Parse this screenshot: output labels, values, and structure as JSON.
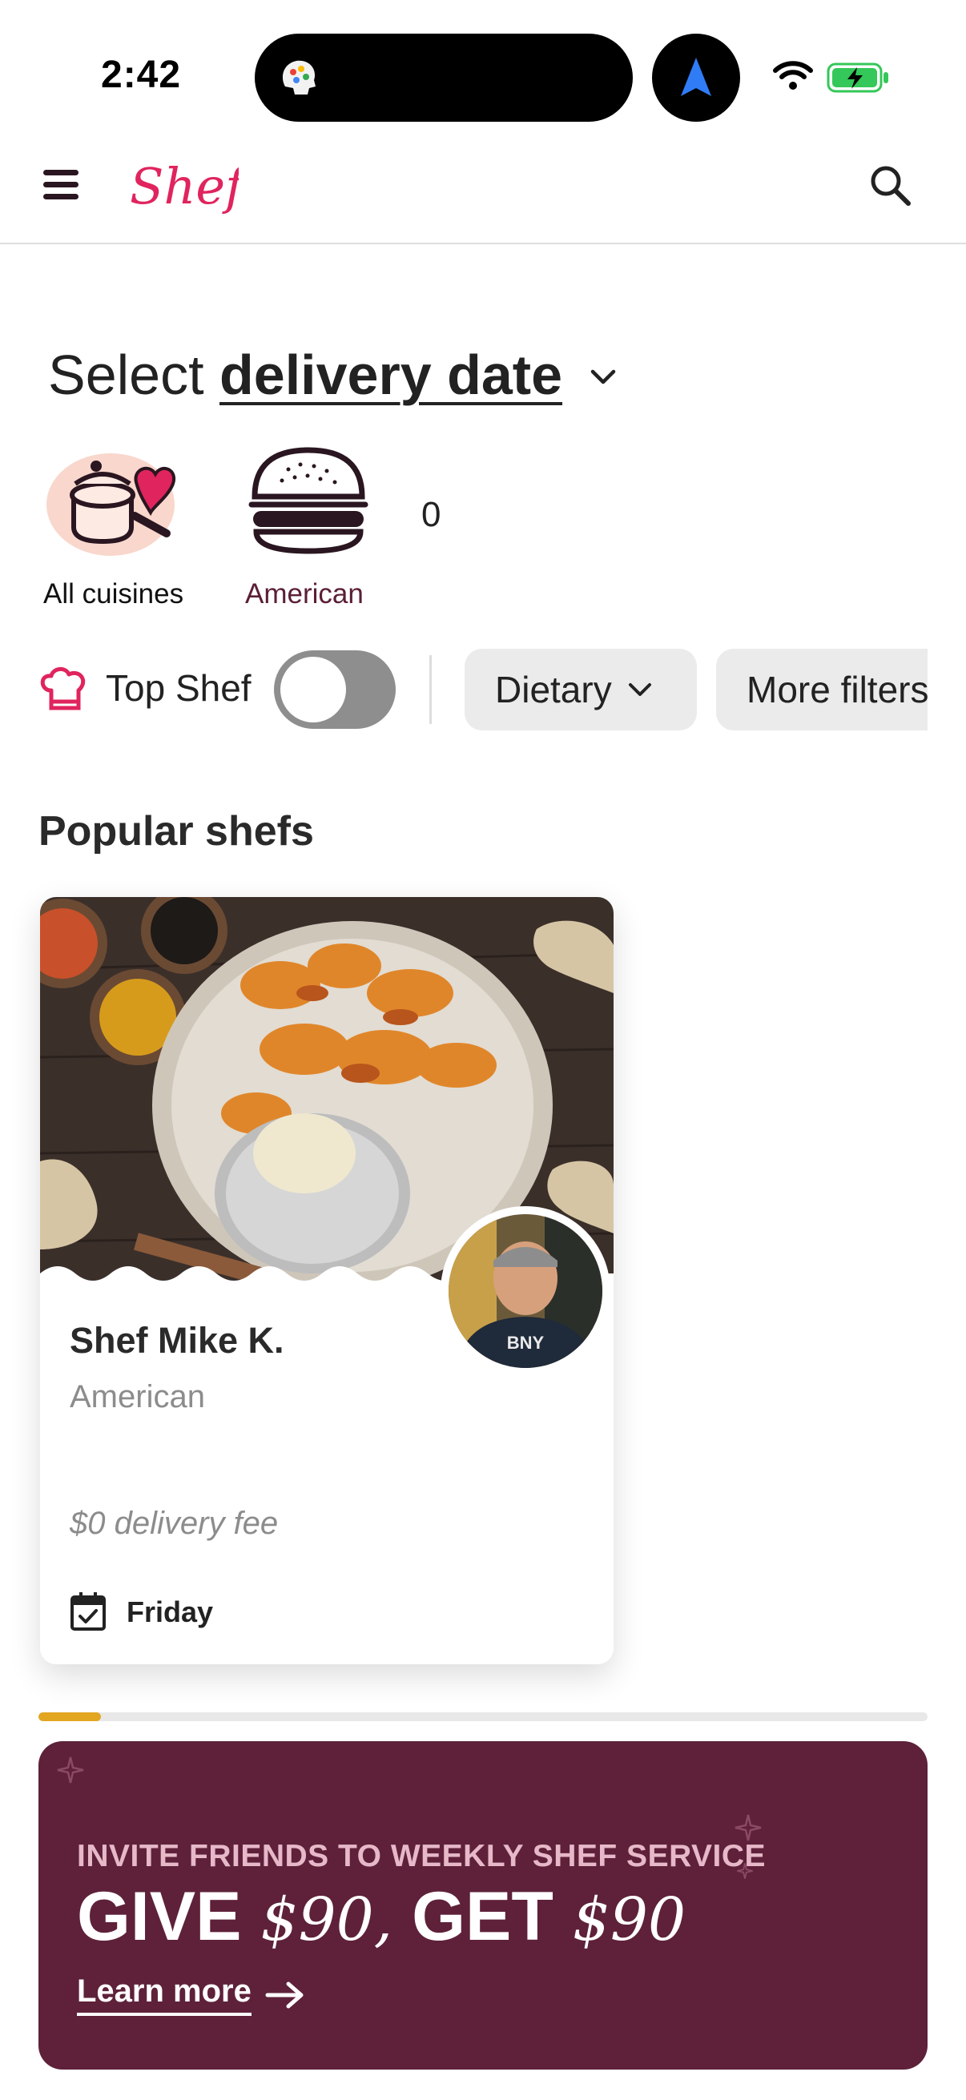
{
  "status_bar": {
    "time": "2:42"
  },
  "nav": {
    "logo_text": "Shef",
    "brand_color": "#e0245e"
  },
  "date_selector": {
    "prefix": "Select",
    "link": "delivery date"
  },
  "cuisines": {
    "items": [
      {
        "label": "All cuisines",
        "icon": "pot-heart-icon"
      },
      {
        "label": "American",
        "icon": "burger-icon"
      }
    ],
    "count": "0"
  },
  "filters": {
    "top_shef_label": "Top Shef",
    "top_shef_enabled": false,
    "dietary_label": "Dietary",
    "more_filters_label": "More filters"
  },
  "popular": {
    "title": "Popular shefs",
    "cards": [
      {
        "name": "Shef Mike K.",
        "cuisine": "American",
        "delivery_fee": "$0 delivery fee",
        "day": "Friday",
        "avatar_shirt_text": "BNY"
      }
    ],
    "carousel_progress": 0.07
  },
  "promo": {
    "kicker": "INVITE FRIENDS TO WEEKLY SHEF SERVICE",
    "give": "GIVE",
    "give_amount": "$90,",
    "get": "GET",
    "get_amount": "$90",
    "link": "Learn more",
    "background": "#5e2139"
  }
}
